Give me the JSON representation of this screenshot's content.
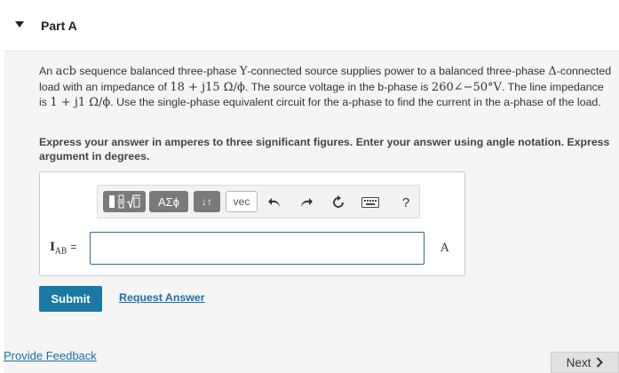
{
  "part": {
    "title": "Part A"
  },
  "question": {
    "text1": "An ",
    "seq": "acb",
    "text2": " sequence balanced three-phase ",
    "conn": "Y",
    "text3": "-connected source supplies power to a balanced three-phase ",
    "delta": "Δ",
    "text4": "-connected load with an impedance of ",
    "impedance": "18 + j15 Ω/ϕ",
    "text5": ". The source voltage in the b-phase is ",
    "voltage": "260∠−50°V",
    "text6": ". The line impedance is ",
    "line_impedance": "1 + j1 Ω/ϕ",
    "text7": ". Use the single-phase equivalent circuit for the a-phase to find the current in the a-phase of the load."
  },
  "instructions": "Express your answer in amperes to three significant figures. Enter your answer using angle notation. Express argument in degrees.",
  "toolbar": {
    "templates_icon": "fraction-sqrt-template-icon",
    "greek_label": "ΑΣϕ",
    "arrows_label": "↓↑",
    "vec_label": "vec",
    "undo_icon": "undo-icon",
    "redo_icon": "redo-icon",
    "reset_icon": "reset-icon",
    "keyboard_icon": "keyboard-icon",
    "help_label": "?"
  },
  "answer": {
    "label_main": "I",
    "label_sub": "AB",
    "equals": "=",
    "value": "",
    "unit": "A"
  },
  "buttons": {
    "submit": "Submit",
    "request_answer": "Request Answer",
    "next": "Next"
  },
  "footer": {
    "feedback": "Provide Feedback"
  },
  "colors": {
    "primary": "#1a7aa4",
    "link": "#1a6fa8",
    "input_border": "#2e6b9e",
    "panel_bg": "#f5f5f5"
  }
}
